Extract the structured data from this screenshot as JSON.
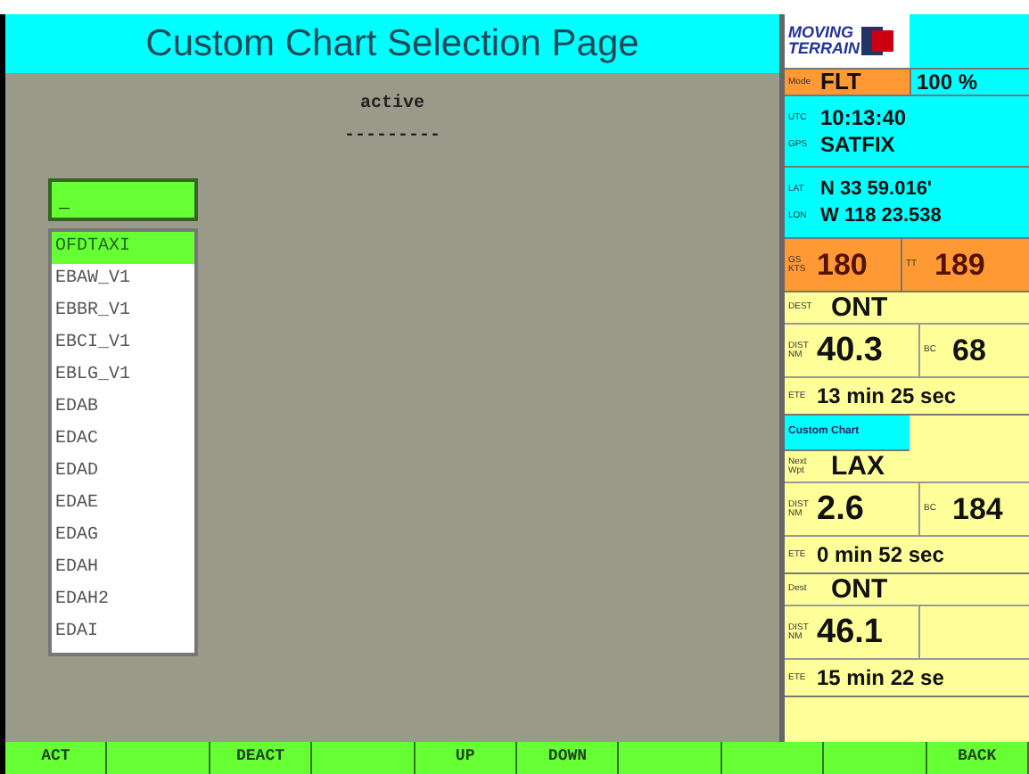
{
  "title": "Custom Chart Selection Page",
  "status": {
    "text": "active",
    "dashes": "---------"
  },
  "input": {
    "value": "_"
  },
  "charts": [
    {
      "label": "OFDTAXI",
      "selected": true
    },
    {
      "label": "EBAW_V1",
      "selected": false
    },
    {
      "label": "EBBR_V1",
      "selected": false
    },
    {
      "label": "EBCI_V1",
      "selected": false
    },
    {
      "label": "EBLG_V1",
      "selected": false
    },
    {
      "label": "EDAB",
      "selected": false
    },
    {
      "label": "EDAC",
      "selected": false
    },
    {
      "label": "EDAD",
      "selected": false
    },
    {
      "label": "EDAE",
      "selected": false
    },
    {
      "label": "EDAG",
      "selected": false
    },
    {
      "label": "EDAH",
      "selected": false
    },
    {
      "label": "EDAH2",
      "selected": false
    },
    {
      "label": "EDAI",
      "selected": false
    }
  ],
  "logo": {
    "line_1": "MOVING",
    "line_2": "TERRAIN"
  },
  "mode": {
    "label": "Mode",
    "value": "FLT",
    "zoom": "100 %"
  },
  "utc": {
    "label": "UTC",
    "value": "10:13:40"
  },
  "gps": {
    "label": "GPS",
    "value": "SATFIX"
  },
  "lat": {
    "label": "LAT",
    "value": "N 33 59.016'"
  },
  "lon": {
    "label": "LON",
    "value": "W 118 23.538"
  },
  "gs": {
    "label": "GS KTS",
    "value": "180"
  },
  "tt": {
    "label": "TT",
    "value": "189"
  },
  "route": [
    {
      "kind": "waypoint",
      "label": "DEST",
      "name": "ONT",
      "dist_label": "DIST NM",
      "dist": "40.3",
      "brg_label": "BC",
      "brg": "68",
      "ete_label": "ETE",
      "ete": "13 min 25 sec"
    },
    {
      "kind": "header",
      "label": "Custom Chart"
    },
    {
      "kind": "waypoint",
      "label": "Next Wpt",
      "name": "LAX",
      "dist_label": "DIST NM",
      "dist": "2.6",
      "brg_label": "BC",
      "brg": "184",
      "ete_label": "ETE",
      "ete": "0 min 52 sec"
    },
    {
      "kind": "waypoint",
      "label": "Dest",
      "name": "ONT",
      "dist_label": "DIST NM",
      "dist": "46.1",
      "ete_label": "ETE",
      "ete": "15 min 22 se"
    }
  ],
  "softkeys": [
    {
      "kind": "labeled",
      "label": "ACT"
    },
    {
      "kind": "blank"
    },
    {
      "kind": "labeled",
      "label": "DEACT"
    },
    {
      "kind": "blank"
    },
    {
      "kind": "labeled",
      "label": "UP"
    },
    {
      "kind": "labeled",
      "label": "DOWN"
    },
    {
      "kind": "blank"
    },
    {
      "kind": "blank"
    },
    {
      "kind": "blank"
    },
    {
      "kind": "labeled",
      "label": "BACK"
    }
  ]
}
